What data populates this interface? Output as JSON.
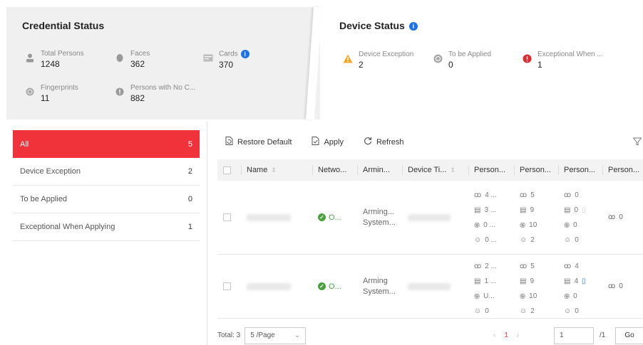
{
  "credential": {
    "title": "Credential Status",
    "total_persons": {
      "label": "Total Persons",
      "value": "1248"
    },
    "faces": {
      "label": "Faces",
      "value": "362"
    },
    "cards": {
      "label": "Cards",
      "value": "370"
    },
    "fingerprints": {
      "label": "Fingerprints",
      "value": "11"
    },
    "no_cred": {
      "label": "Persons with No C...",
      "value": "882"
    }
  },
  "device": {
    "title": "Device Status",
    "exception": {
      "label": "Device Exception",
      "value": "2"
    },
    "to_apply": {
      "label": "To be Applied",
      "value": "0"
    },
    "exceptional_when": {
      "label": "Exceptional When ...",
      "value": "1"
    }
  },
  "filters": [
    {
      "label": "All",
      "count": "5"
    },
    {
      "label": "Device Exception",
      "count": "2"
    },
    {
      "label": "To be Applied",
      "count": "0"
    },
    {
      "label": "Exceptional When Applying",
      "count": "1"
    }
  ],
  "toolbar": {
    "restore": "Restore Default",
    "apply": "Apply",
    "refresh": "Refresh"
  },
  "columns": [
    "Name",
    "Netwo...",
    "Armin...",
    "Device Ti...",
    "Person...",
    "Person...",
    "Person...",
    "Person..."
  ],
  "rows": [
    {
      "network": "O...",
      "arming": [
        "Arming...",
        "System..."
      ],
      "p1": [
        "4 ...",
        "3 ...",
        "0 ...",
        "0 ..."
      ],
      "p2": [
        "5",
        "9",
        "10",
        "2"
      ],
      "p3": [
        "0",
        "0",
        "0",
        "0"
      ],
      "p4": "0"
    },
    {
      "network": "O...",
      "arming": [
        "Arming",
        "System..."
      ],
      "p1": [
        "2 ...",
        "1 ...",
        "U...",
        "0"
      ],
      "p2": [
        "5",
        "9",
        "10",
        "2"
      ],
      "p3": [
        "4",
        "4",
        "0",
        "0"
      ],
      "p4": "0"
    }
  ],
  "footer": {
    "total": "Total: 3",
    "page_size": "5 /Page",
    "current_page": "1",
    "jump_value": "1",
    "total_pages": "/1",
    "go": "Go"
  },
  "colors": {
    "accent": "#f0333a",
    "info": "#1a73e8",
    "ok": "#48a33d",
    "warning": "#f5a623"
  }
}
